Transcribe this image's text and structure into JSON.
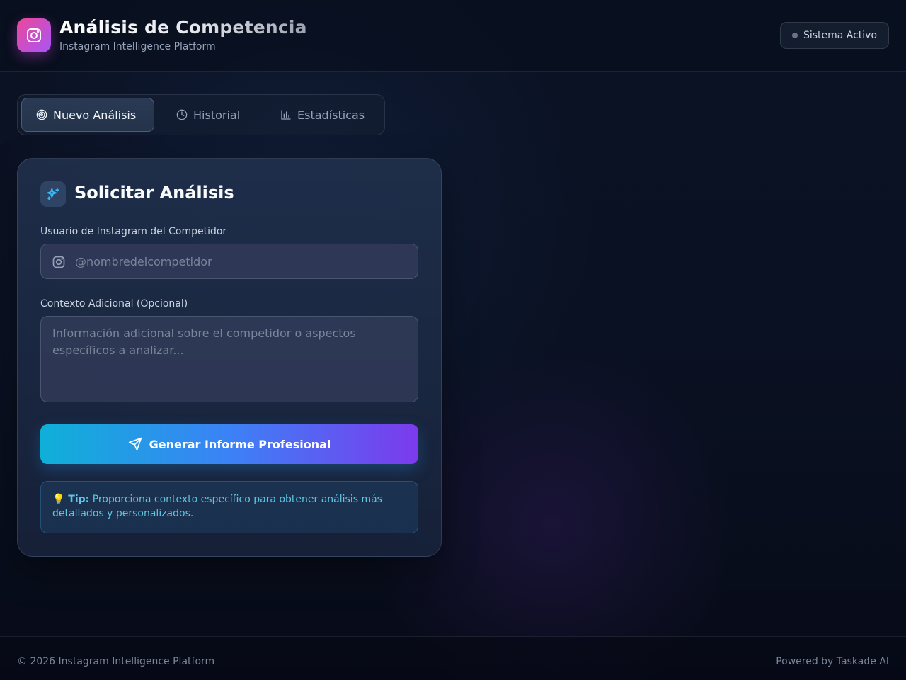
{
  "header": {
    "title": "Análisis de Competencia",
    "subtitle": "Instagram Intelligence Platform",
    "status_label": "Sistema Activo",
    "logo_icon": "instagram-icon"
  },
  "tabs": [
    {
      "label": "Nuevo Análisis",
      "icon": "target-icon",
      "active": true
    },
    {
      "label": "Historial",
      "icon": "clock-icon",
      "active": false
    },
    {
      "label": "Estadísticas",
      "icon": "bar-chart-icon",
      "active": false
    }
  ],
  "form": {
    "title": "Solicitar Análisis",
    "title_icon": "sparkles-icon",
    "username_label": "Usuario de Instagram del Competidor",
    "username_placeholder": "@nombredelcompetidor",
    "username_value": "",
    "context_label": "Contexto Adicional (Opcional)",
    "context_placeholder": "Información adicional sobre el competidor o aspectos específicos a analizar...",
    "context_value": "",
    "submit_label": "Generar Informe Profesional",
    "submit_icon": "send-icon",
    "tip_prefix": "💡 Tip:",
    "tip_text": "Proporciona contexto específico para obtener análisis más detallados y personalizados."
  },
  "footer": {
    "copyright": "© 2026 Instagram Intelligence Platform",
    "powered_by": "Powered by Taskade AI"
  },
  "colors": {
    "accent_start": "#0fb0d8",
    "accent_mid": "#3b82f6",
    "accent_end": "#7c3aed",
    "logo_start": "#ec4899",
    "logo_end": "#a855f7",
    "tip_text": "#5ec6e4"
  }
}
